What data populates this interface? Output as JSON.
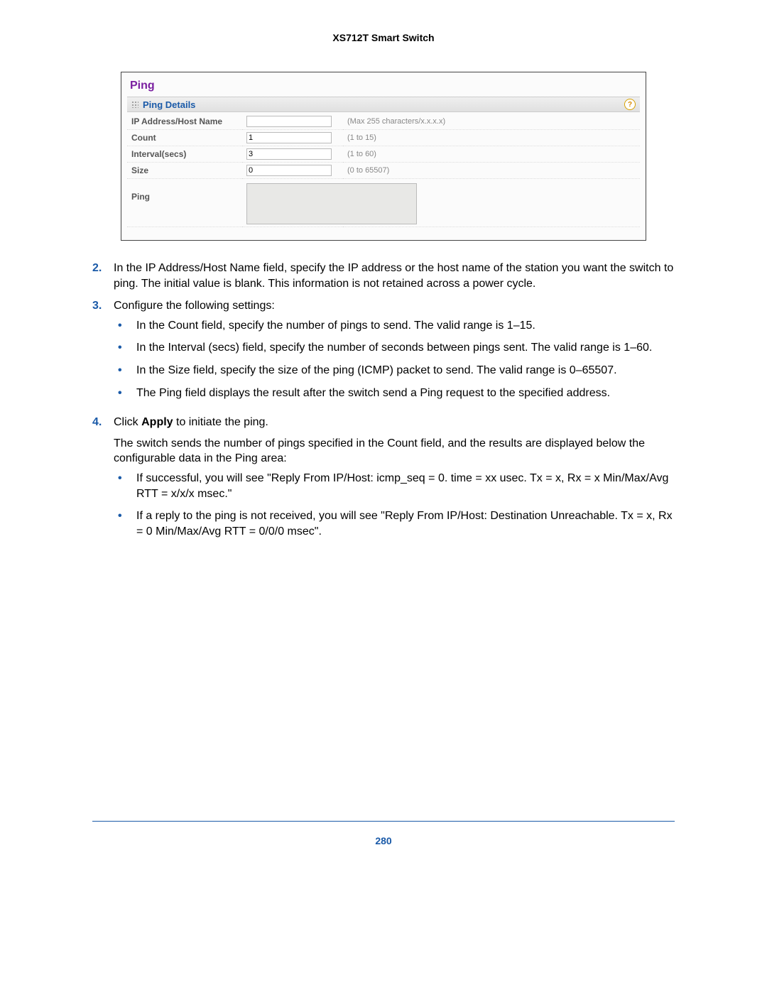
{
  "doc": {
    "header": "XS712T Smart Switch",
    "page_number": "280"
  },
  "panel": {
    "title": "Ping",
    "section_label": "Ping Details",
    "help_icon_label": "?",
    "rows": {
      "ip_label": "IP Address/Host Name",
      "ip_value": "",
      "ip_hint": "(Max 255 characters/x.x.x.x)",
      "count_label": "Count",
      "count_value": "1",
      "count_hint": "(1 to 15)",
      "interval_label": "Interval(secs)",
      "interval_value": "3",
      "interval_hint": "(1 to 60)",
      "size_label": "Size",
      "size_value": "0",
      "size_hint": "(0 to 65507)",
      "result_label": "Ping"
    }
  },
  "steps": {
    "s2": {
      "num": "2.",
      "text": "In the IP Address/Host Name field, specify the IP address or the host name of the station you want the switch to ping. The initial value is blank. This information is not retained across a power cycle."
    },
    "s3": {
      "num": "3.",
      "text": "Configure the following settings:",
      "bullets": {
        "b1": "In the Count field, specify the number of pings to send. The valid range is 1–15.",
        "b2": "In the Interval (secs) field, specify the number of seconds between pings sent. The valid range is 1–60.",
        "b3": "In the Size field, specify the size of the ping (ICMP) packet to send. The valid range is 0–65507.",
        "b4": "The Ping field displays the result after the switch send a Ping request to the specified address."
      }
    },
    "s4": {
      "num": "4.",
      "pre": "Click ",
      "bold": "Apply",
      "post": " to initiate the ping.",
      "para": "The switch sends the number of pings specified in the Count field, and the results are displayed below the configurable data in the Ping area:",
      "bullets": {
        "b1": "If successful, you will see \"Reply From IP/Host: icmp_seq = 0. time = xx usec. Tx = x, Rx = x Min/Max/Avg RTT = x/x/x msec.\"",
        "b2": "If a reply to the ping is not received, you will see \"Reply From IP/Host: Destination Unreachable. Tx = x, Rx = 0 Min/Max/Avg RTT = 0/0/0 msec\"."
      }
    }
  }
}
